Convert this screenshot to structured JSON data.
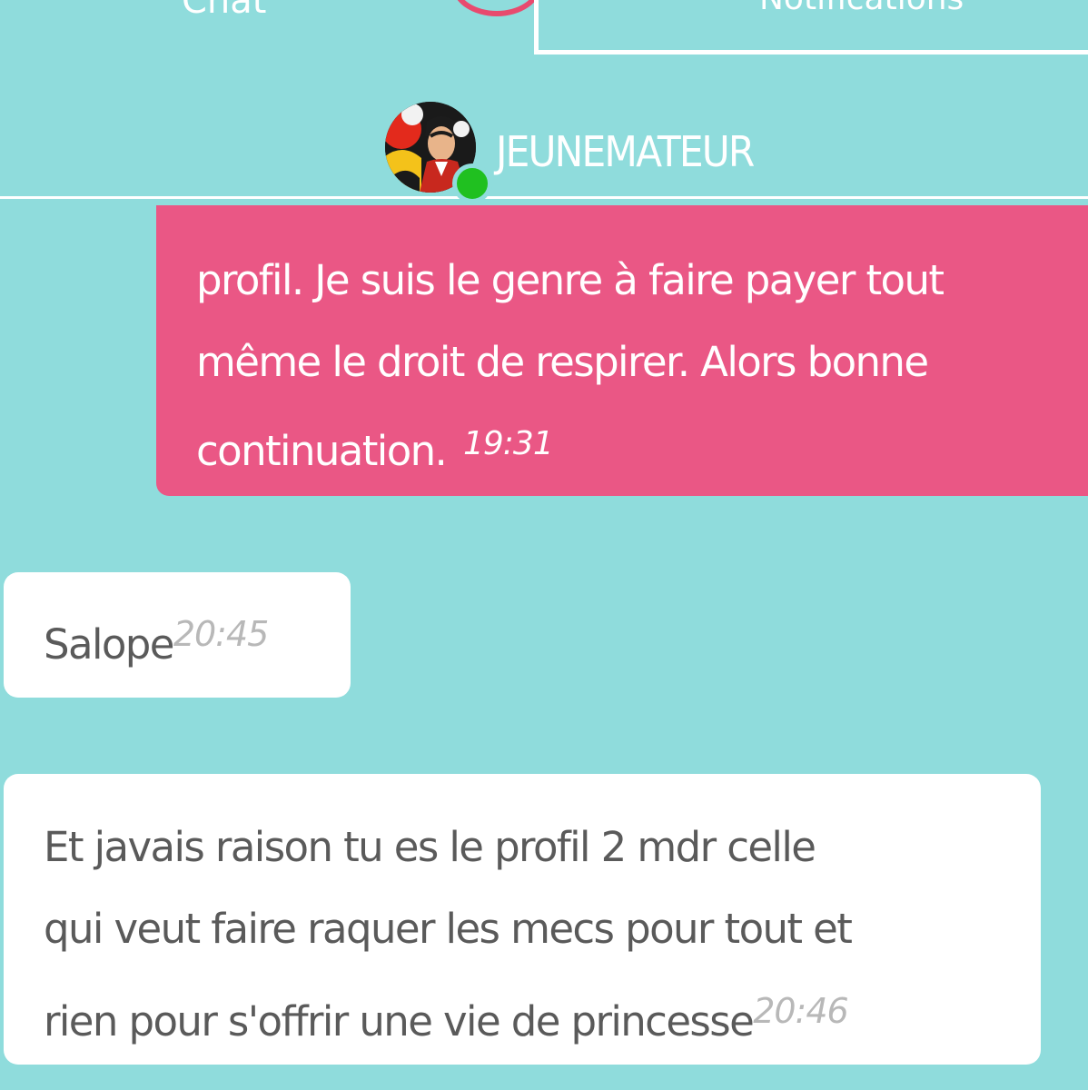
{
  "tabs": {
    "chat": "Chat",
    "notifications": "Notifications"
  },
  "header": {
    "username": "JEUNEMATEUR",
    "status": "online"
  },
  "messages": [
    {
      "direction": "outgoing",
      "lines": [
        "profil. Je suis le genre à faire payer tout",
        "même le droit de respirer. Alors bonne",
        "continuation."
      ],
      "time": "19:31"
    },
    {
      "direction": "incoming",
      "lines": [
        "Salope"
      ],
      "time": "20:45"
    },
    {
      "direction": "incoming",
      "lines": [
        "Et javais raison tu es le profil 2 mdr celle",
        "qui veut faire raquer les mecs pour tout et",
        "rien pour s'offrir une vie de princesse"
      ],
      "time": "20:46"
    }
  ],
  "colors": {
    "background": "#8fdcdc",
    "outgoing_bubble": "#ea5785",
    "incoming_bubble": "#ffffff",
    "incoming_text": "#5a5a5a",
    "timestamp_incoming": "#b8b8b8",
    "online_dot": "#20c020"
  }
}
